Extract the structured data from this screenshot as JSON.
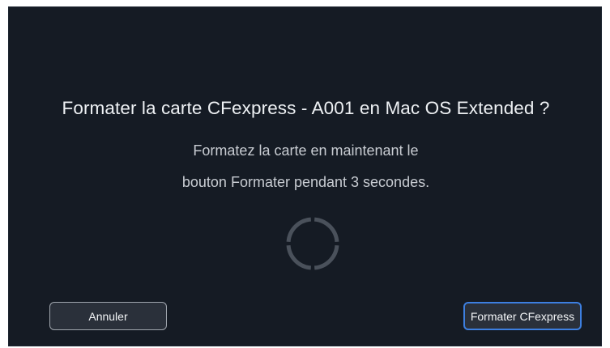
{
  "dialog": {
    "title": "Formater la carte CFexpress - A001 en Mac OS Extended ?",
    "message_line1": "Formatez la carte en maintenant le",
    "message_line2": "bouton Formater pendant 3 secondes."
  },
  "progress": {
    "icon": "progress-ring-icon",
    "segments": 4,
    "filled_segments": 0
  },
  "buttons": {
    "cancel_label": "Annuler",
    "format_label": "Formater CFexpress"
  },
  "colors": {
    "background": "#151b24",
    "title_text": "#eef1f4",
    "message_text": "#c8ccd2",
    "button_bg": "#2a303a",
    "primary_border": "#3d7fe0",
    "ring_segment": "#4a515b"
  }
}
